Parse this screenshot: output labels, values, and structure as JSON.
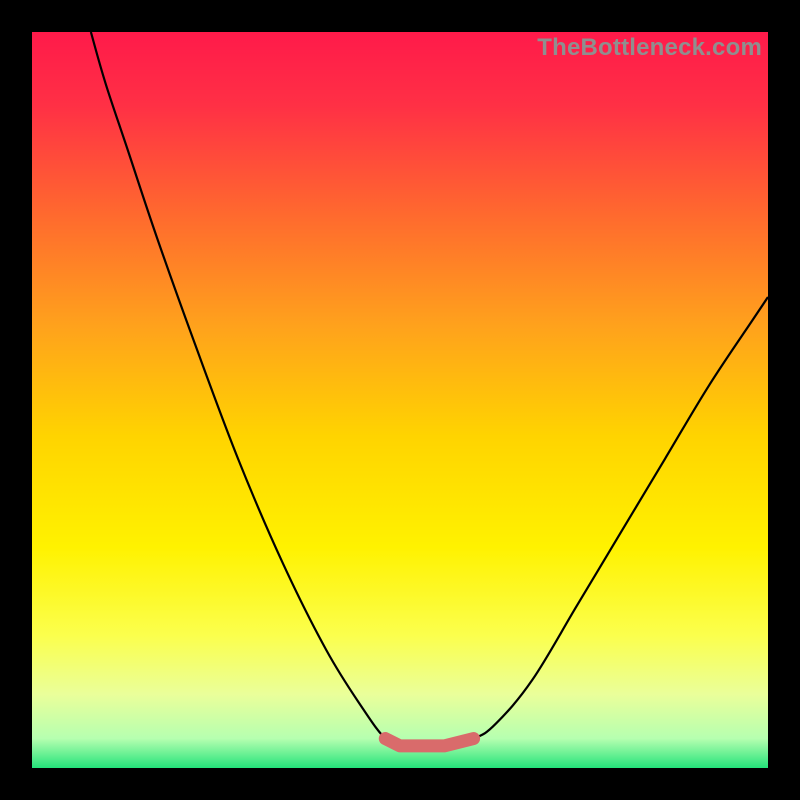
{
  "watermark": "TheBottleneck.com",
  "chart_data": {
    "type": "line",
    "title": "",
    "xlabel": "",
    "ylabel": "",
    "xlim": [
      0,
      100
    ],
    "ylim": [
      0,
      100
    ],
    "grid": false,
    "legend": false,
    "curve_points": [
      {
        "x": 8,
        "y": 100
      },
      {
        "x": 10,
        "y": 93
      },
      {
        "x": 13,
        "y": 84
      },
      {
        "x": 17,
        "y": 72
      },
      {
        "x": 22,
        "y": 58
      },
      {
        "x": 28,
        "y": 42
      },
      {
        "x": 34,
        "y": 28
      },
      {
        "x": 40,
        "y": 16
      },
      {
        "x": 45,
        "y": 8
      },
      {
        "x": 48,
        "y": 4
      },
      {
        "x": 50,
        "y": 3
      },
      {
        "x": 53,
        "y": 3
      },
      {
        "x": 56,
        "y": 3
      },
      {
        "x": 60,
        "y": 4
      },
      {
        "x": 63,
        "y": 6
      },
      {
        "x": 68,
        "y": 12
      },
      {
        "x": 74,
        "y": 22
      },
      {
        "x": 80,
        "y": 32
      },
      {
        "x": 86,
        "y": 42
      },
      {
        "x": 92,
        "y": 52
      },
      {
        "x": 98,
        "y": 61
      },
      {
        "x": 100,
        "y": 64
      }
    ],
    "highlight_region": {
      "x_start": 47,
      "x_end": 61,
      "y": 3
    },
    "gradient_stops": [
      {
        "offset": 0.0,
        "color": "#ff1a4a"
      },
      {
        "offset": 0.1,
        "color": "#ff3045"
      },
      {
        "offset": 0.25,
        "color": "#ff6a2e"
      },
      {
        "offset": 0.4,
        "color": "#ffa21c"
      },
      {
        "offset": 0.55,
        "color": "#ffd400"
      },
      {
        "offset": 0.7,
        "color": "#fff200"
      },
      {
        "offset": 0.82,
        "color": "#fbff4d"
      },
      {
        "offset": 0.9,
        "color": "#eaff9a"
      },
      {
        "offset": 0.96,
        "color": "#b6ffb0"
      },
      {
        "offset": 1.0,
        "color": "#24e37a"
      }
    ]
  }
}
